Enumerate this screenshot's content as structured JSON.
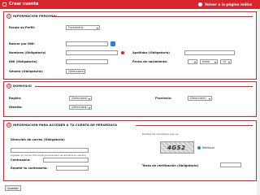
{
  "header": {
    "title": "Crear cuenta",
    "back_label": "Volver a la página índice"
  },
  "section1": {
    "number": "1",
    "title": "INFORMACIÓN PERSONAL",
    "profile_label": "Escoja su Perfil:",
    "profile_value": "Funcionario",
    "search_dni_label": "Buscar por DNI:",
    "names_label": "Nombres (Obligatorio)",
    "surnames_label": "Apellidos (Obligatorio)",
    "dni_label": "DNI (Obligatorio)",
    "birth_label": "Fecha de nacimiento:",
    "birth_month": "enero",
    "birth_day": "14",
    "gender_label": "Género (Obligatorio)",
    "gender_value": "(Seleccione)"
  },
  "section2": {
    "number": "2",
    "title": "DOMICILIO",
    "region_label": "Región:",
    "region_value": "(Seleccione)",
    "province_label": "Provincia:",
    "province_value": "(Seleccione)",
    "district_label": "Distrito:",
    "district_value": "(Seleccione)"
  },
  "section3": {
    "number": "3",
    "title": "INFORMACIÓN PARA ACCEDER A TU CUENTA DE PERUEDUCA",
    "email_label": "Dirección de correo (Obligatorio)",
    "email_hint": "Ingrese un correo funcional porque aquí se enviará su usuario",
    "password_label": "Contraseña:",
    "repeat_label": "Repetir tu contraseña:",
    "captcha_label": "Escriba los caracteres que ve:",
    "captcha_text": "4GS2",
    "refresh_label": "Refrescar",
    "verify_label": "Texto de verificación (Obligatorio)"
  },
  "footer": {
    "submit_label": "Guardar"
  },
  "colors": {
    "accent": "#d8242d",
    "link": "#2f7fd6"
  }
}
